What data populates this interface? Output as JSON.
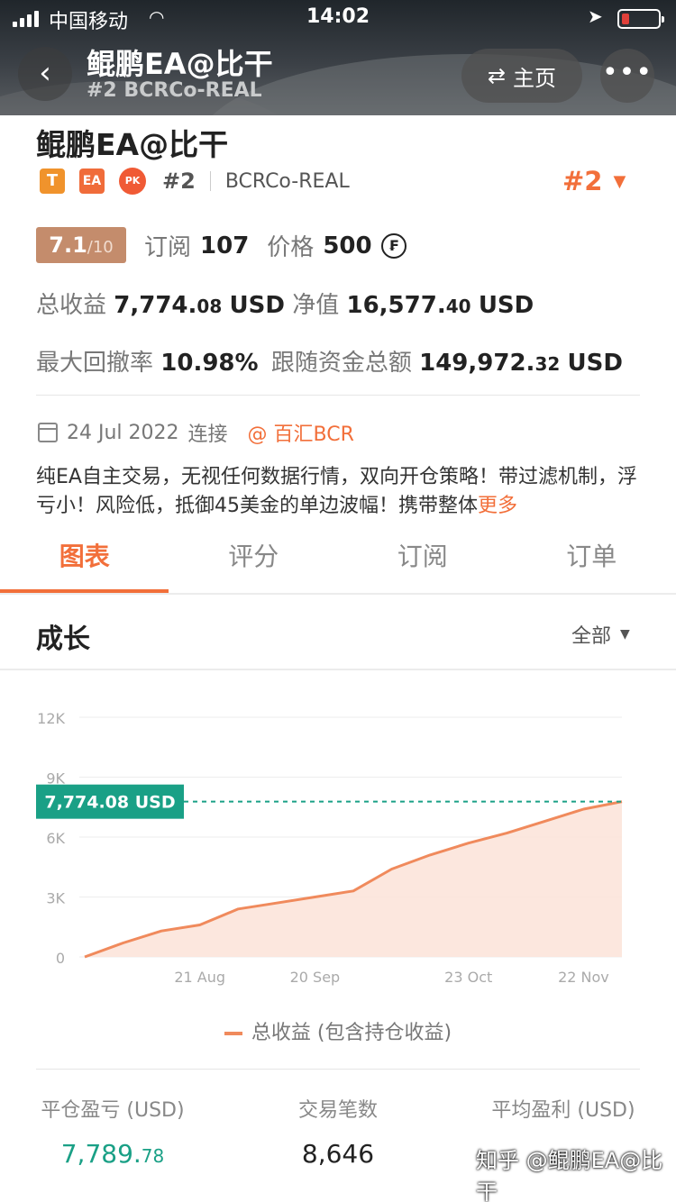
{
  "status_bar": {
    "carrier": "中国移动",
    "time": "14:02"
  },
  "header": {
    "title": "鲲鹏EA@比干",
    "subtitle": "#2 BCRCo-REAL",
    "home_label": "主页",
    "more_label": "•••"
  },
  "profile": {
    "name": "鲲鹏EA@比干",
    "badges": [
      "T",
      "EA",
      "PK"
    ],
    "rank": "#2",
    "broker": "BCRCo-REAL",
    "rank_right": "#2",
    "score": {
      "value": "7.1",
      "denominator": "/10"
    },
    "subscribe_label": "订阅",
    "subscribe_count": "107",
    "price_label": "价格",
    "price_value": "500",
    "currency_symbol": "₣"
  },
  "stats": {
    "total_profit_label": "总收益",
    "total_profit_main": "7,774.",
    "total_profit_dec": "08",
    "total_profit_unit": "USD",
    "equity_label": "净值",
    "equity_main": "16,577.",
    "equity_dec": "40",
    "equity_unit": "USD",
    "drawdown_label": "最大回撤率",
    "drawdown_value": "10.98%",
    "follow_label": "跟随资金总额",
    "follow_main": "149,972.",
    "follow_dec": "32",
    "follow_unit": "USD"
  },
  "connection": {
    "date": "24 Jul 2022",
    "connected_label": "连接",
    "broker_link": "@ 百汇BCR"
  },
  "description": {
    "text": "纯EA自主交易，无视任何数据行情，双向开仓策略！带过滤机制，浮亏小！风险低，抵御45美金的单边波幅！携带整体",
    "more_label": "更多"
  },
  "tabs": [
    "图表",
    "评分",
    "订阅",
    "订单"
  ],
  "growth": {
    "title": "成长",
    "range_label": "全部"
  },
  "chart_data": {
    "type": "area",
    "title": "",
    "xlabel": "",
    "ylabel": "",
    "y_ticks": [
      "0",
      "3K",
      "6K",
      "9K",
      "12K"
    ],
    "ylim": [
      0,
      12000
    ],
    "x_ticks": [
      "21 Aug",
      "20 Sep",
      "23 Oct",
      "22 Nov"
    ],
    "x": [
      "24 Jul",
      "4 Aug",
      "14 Aug",
      "21 Aug",
      "1 Sep",
      "10 Sep",
      "20 Sep",
      "27 Sep",
      "5 Oct",
      "13 Oct",
      "23 Oct",
      "1 Nov",
      "10 Nov",
      "22 Nov",
      "28 Nov"
    ],
    "series": [
      {
        "name": "总收益 (包含持仓收益)",
        "values": [
          0,
          700,
          1300,
          1600,
          2400,
          2700,
          3000,
          3300,
          4400,
          5100,
          5700,
          6200,
          6800,
          7400,
          7774.08
        ]
      }
    ],
    "current_value_label": "7,774.08 USD",
    "grid": true,
    "colors": {
      "line": "#f08a5c",
      "fill": "#fbe3d8",
      "marker": "#1aa086"
    }
  },
  "legend_label": "总收益 (包含持仓收益)",
  "metrics": [
    {
      "label": "平仓盈亏 (USD)",
      "main": "7,789.",
      "dec": "78"
    },
    {
      "label": "交易笔数",
      "main": "8,646",
      "dec": ""
    },
    {
      "label": "平均盈利 (USD)",
      "main": "",
      "dec": ""
    }
  ],
  "watermark": "知乎 @鲲鹏EA@比干"
}
